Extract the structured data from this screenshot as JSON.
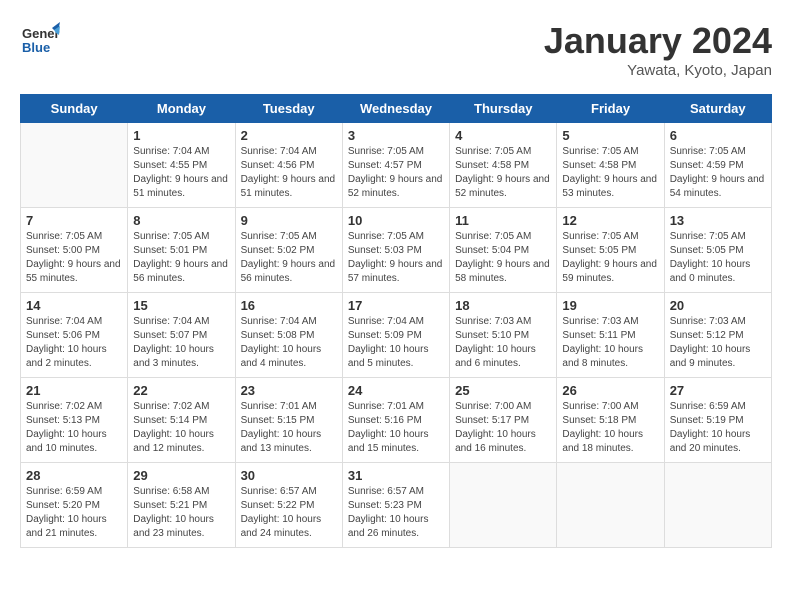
{
  "header": {
    "logo_general": "General",
    "logo_blue": "Blue",
    "month_title": "January 2024",
    "location": "Yawata, Kyoto, Japan"
  },
  "weekdays": [
    "Sunday",
    "Monday",
    "Tuesday",
    "Wednesday",
    "Thursday",
    "Friday",
    "Saturday"
  ],
  "weeks": [
    [
      {
        "day": "",
        "sunrise": "",
        "sunset": "",
        "daylight": ""
      },
      {
        "day": "1",
        "sunrise": "Sunrise: 7:04 AM",
        "sunset": "Sunset: 4:55 PM",
        "daylight": "Daylight: 9 hours and 51 minutes."
      },
      {
        "day": "2",
        "sunrise": "Sunrise: 7:04 AM",
        "sunset": "Sunset: 4:56 PM",
        "daylight": "Daylight: 9 hours and 51 minutes."
      },
      {
        "day": "3",
        "sunrise": "Sunrise: 7:05 AM",
        "sunset": "Sunset: 4:57 PM",
        "daylight": "Daylight: 9 hours and 52 minutes."
      },
      {
        "day": "4",
        "sunrise": "Sunrise: 7:05 AM",
        "sunset": "Sunset: 4:58 PM",
        "daylight": "Daylight: 9 hours and 52 minutes."
      },
      {
        "day": "5",
        "sunrise": "Sunrise: 7:05 AM",
        "sunset": "Sunset: 4:58 PM",
        "daylight": "Daylight: 9 hours and 53 minutes."
      },
      {
        "day": "6",
        "sunrise": "Sunrise: 7:05 AM",
        "sunset": "Sunset: 4:59 PM",
        "daylight": "Daylight: 9 hours and 54 minutes."
      }
    ],
    [
      {
        "day": "7",
        "sunrise": "Sunrise: 7:05 AM",
        "sunset": "Sunset: 5:00 PM",
        "daylight": "Daylight: 9 hours and 55 minutes."
      },
      {
        "day": "8",
        "sunrise": "Sunrise: 7:05 AM",
        "sunset": "Sunset: 5:01 PM",
        "daylight": "Daylight: 9 hours and 56 minutes."
      },
      {
        "day": "9",
        "sunrise": "Sunrise: 7:05 AM",
        "sunset": "Sunset: 5:02 PM",
        "daylight": "Daylight: 9 hours and 56 minutes."
      },
      {
        "day": "10",
        "sunrise": "Sunrise: 7:05 AM",
        "sunset": "Sunset: 5:03 PM",
        "daylight": "Daylight: 9 hours and 57 minutes."
      },
      {
        "day": "11",
        "sunrise": "Sunrise: 7:05 AM",
        "sunset": "Sunset: 5:04 PM",
        "daylight": "Daylight: 9 hours and 58 minutes."
      },
      {
        "day": "12",
        "sunrise": "Sunrise: 7:05 AM",
        "sunset": "Sunset: 5:05 PM",
        "daylight": "Daylight: 9 hours and 59 minutes."
      },
      {
        "day": "13",
        "sunrise": "Sunrise: 7:05 AM",
        "sunset": "Sunset: 5:05 PM",
        "daylight": "Daylight: 10 hours and 0 minutes."
      }
    ],
    [
      {
        "day": "14",
        "sunrise": "Sunrise: 7:04 AM",
        "sunset": "Sunset: 5:06 PM",
        "daylight": "Daylight: 10 hours and 2 minutes."
      },
      {
        "day": "15",
        "sunrise": "Sunrise: 7:04 AM",
        "sunset": "Sunset: 5:07 PM",
        "daylight": "Daylight: 10 hours and 3 minutes."
      },
      {
        "day": "16",
        "sunrise": "Sunrise: 7:04 AM",
        "sunset": "Sunset: 5:08 PM",
        "daylight": "Daylight: 10 hours and 4 minutes."
      },
      {
        "day": "17",
        "sunrise": "Sunrise: 7:04 AM",
        "sunset": "Sunset: 5:09 PM",
        "daylight": "Daylight: 10 hours and 5 minutes."
      },
      {
        "day": "18",
        "sunrise": "Sunrise: 7:03 AM",
        "sunset": "Sunset: 5:10 PM",
        "daylight": "Daylight: 10 hours and 6 minutes."
      },
      {
        "day": "19",
        "sunrise": "Sunrise: 7:03 AM",
        "sunset": "Sunset: 5:11 PM",
        "daylight": "Daylight: 10 hours and 8 minutes."
      },
      {
        "day": "20",
        "sunrise": "Sunrise: 7:03 AM",
        "sunset": "Sunset: 5:12 PM",
        "daylight": "Daylight: 10 hours and 9 minutes."
      }
    ],
    [
      {
        "day": "21",
        "sunrise": "Sunrise: 7:02 AM",
        "sunset": "Sunset: 5:13 PM",
        "daylight": "Daylight: 10 hours and 10 minutes."
      },
      {
        "day": "22",
        "sunrise": "Sunrise: 7:02 AM",
        "sunset": "Sunset: 5:14 PM",
        "daylight": "Daylight: 10 hours and 12 minutes."
      },
      {
        "day": "23",
        "sunrise": "Sunrise: 7:01 AM",
        "sunset": "Sunset: 5:15 PM",
        "daylight": "Daylight: 10 hours and 13 minutes."
      },
      {
        "day": "24",
        "sunrise": "Sunrise: 7:01 AM",
        "sunset": "Sunset: 5:16 PM",
        "daylight": "Daylight: 10 hours and 15 minutes."
      },
      {
        "day": "25",
        "sunrise": "Sunrise: 7:00 AM",
        "sunset": "Sunset: 5:17 PM",
        "daylight": "Daylight: 10 hours and 16 minutes."
      },
      {
        "day": "26",
        "sunrise": "Sunrise: 7:00 AM",
        "sunset": "Sunset: 5:18 PM",
        "daylight": "Daylight: 10 hours and 18 minutes."
      },
      {
        "day": "27",
        "sunrise": "Sunrise: 6:59 AM",
        "sunset": "Sunset: 5:19 PM",
        "daylight": "Daylight: 10 hours and 20 minutes."
      }
    ],
    [
      {
        "day": "28",
        "sunrise": "Sunrise: 6:59 AM",
        "sunset": "Sunset: 5:20 PM",
        "daylight": "Daylight: 10 hours and 21 minutes."
      },
      {
        "day": "29",
        "sunrise": "Sunrise: 6:58 AM",
        "sunset": "Sunset: 5:21 PM",
        "daylight": "Daylight: 10 hours and 23 minutes."
      },
      {
        "day": "30",
        "sunrise": "Sunrise: 6:57 AM",
        "sunset": "Sunset: 5:22 PM",
        "daylight": "Daylight: 10 hours and 24 minutes."
      },
      {
        "day": "31",
        "sunrise": "Sunrise: 6:57 AM",
        "sunset": "Sunset: 5:23 PM",
        "daylight": "Daylight: 10 hours and 26 minutes."
      },
      {
        "day": "",
        "sunrise": "",
        "sunset": "",
        "daylight": ""
      },
      {
        "day": "",
        "sunrise": "",
        "sunset": "",
        "daylight": ""
      },
      {
        "day": "",
        "sunrise": "",
        "sunset": "",
        "daylight": ""
      }
    ]
  ]
}
